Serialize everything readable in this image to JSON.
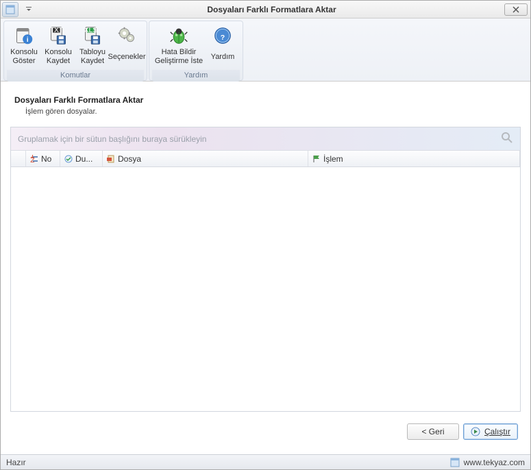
{
  "window": {
    "title": "Dosyaları Farklı Formatlara Aktar"
  },
  "ribbon": {
    "groups": {
      "commands": {
        "label": "Komutlar",
        "items": {
          "show_console": "Konsolu\nGöster",
          "save_console": "Konsolu\nKaydet",
          "save_table": "Tabloyu\nKaydet",
          "options": "Seçenekler"
        }
      },
      "help": {
        "label": "Yardım",
        "items": {
          "report": "Hata Bildir\nGeliştirme İste",
          "help": "Yardım"
        }
      }
    }
  },
  "wizard": {
    "title": "Dosyaları Farklı Formatlara Aktar",
    "subtitle": "İşlem gören dosyalar."
  },
  "grid": {
    "group_placeholder": "Gruplamak için bir sütun başlığını buraya sürükleyin",
    "columns": {
      "no": "No",
      "du": "Du...",
      "dosya": "Dosya",
      "islem": "İşlem"
    }
  },
  "buttons": {
    "back": "< Geri",
    "run": "Çalıştır"
  },
  "status": {
    "ready": "Hazır",
    "link": "www.tekyaz.com"
  }
}
